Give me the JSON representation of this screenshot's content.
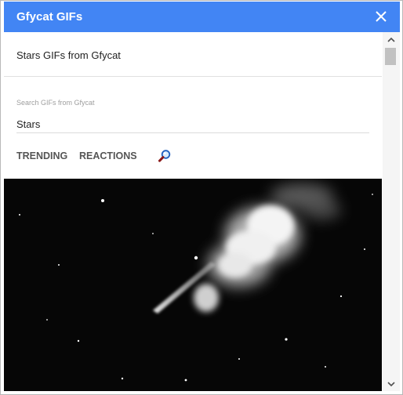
{
  "window": {
    "title": "Gfycat GIFs",
    "close_icon": "close-icon",
    "header_color": "#4285f4"
  },
  "main": {
    "subtitle": "Stars GIFs from Gfycat",
    "search": {
      "label": "Search GIFs from Gfycat",
      "value": "Stars"
    },
    "tabs": [
      {
        "label": "TRENDING"
      },
      {
        "label": "REACTIONS"
      }
    ],
    "search_button_icon": "magnifier-icon",
    "result": {
      "type": "gif",
      "subject": "stars"
    }
  },
  "scrollbar": {
    "up_icon": "scroll-up-arrow-icon",
    "down_icon": "scroll-down-arrow-icon"
  }
}
